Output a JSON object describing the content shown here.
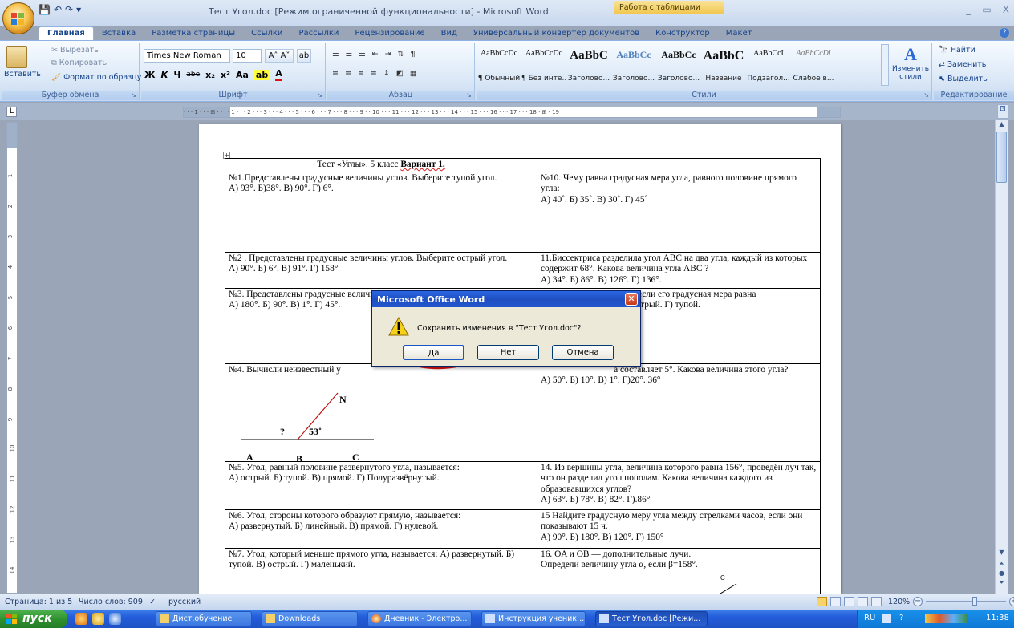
{
  "window": {
    "title": "Тест Угол.doc [Режим ограниченной функциональности] - Microsoft Word",
    "context_group": "Работа с таблицами",
    "controls": [
      "_",
      "▭",
      "X"
    ]
  },
  "qat": [
    "💾",
    "↶",
    "↷",
    "▾"
  ],
  "tabs": [
    "Главная",
    "Вставка",
    "Разметка страницы",
    "Ссылки",
    "Рассылки",
    "Рецензирование",
    "Вид",
    "Универсальный конвертер документов",
    "Конструктор",
    "Макет"
  ],
  "ribbon": {
    "clipboard": {
      "paste": "Вставить",
      "cut": "Вырезать",
      "copy": "Копировать",
      "format": "Формат по образцу",
      "label": "Буфер обмена"
    },
    "font": {
      "name": "Times New Roman",
      "size": "10",
      "label": "Шрифт",
      "row2": [
        "Ж",
        "К",
        "Ч",
        "abe",
        "x₂",
        "x²",
        "Aa"
      ]
    },
    "paragraph": {
      "label": "Абзац"
    },
    "styles": {
      "label": "Стили",
      "items": [
        {
          "sample": "AaBbCcDc",
          "name": "¶ Обычный"
        },
        {
          "sample": "AaBbCcDc",
          "name": "¶ Без инте..."
        },
        {
          "sample": "AaBbC",
          "name": "Заголово..."
        },
        {
          "sample": "AaBbCc",
          "name": "Заголово..."
        },
        {
          "sample": "AaBbCc",
          "name": "Заголово..."
        },
        {
          "sample": "AaBbC",
          "name": "Название"
        },
        {
          "sample": "AaBbCcI",
          "name": "Подзагол..."
        },
        {
          "sample": "AaBbCcDi",
          "name": "Слабое в..."
        }
      ],
      "change": "Изменить стили"
    },
    "editing": {
      "find": "Найти",
      "replace": "Заменить",
      "select": "Выделить",
      "label": "Редактирование"
    }
  },
  "ruler": {
    "h_text": "· · · 1 · · · ⊞ · · · · 1 · · · 2 · · · 3 · · · 4 · · · 5 · · · 6 · · · 7 · · · 8 · · · 9 · · 10 · · · 11 · · · 12 · · · 13 · · · 14 · · · 15 · · · 16 · · · 17 · · · 18 · ⊞ · 19",
    "v_nums": [
      "1",
      "2",
      "3",
      "4",
      "5",
      "6",
      "7",
      "8",
      "9",
      "10",
      "11",
      "12",
      "13",
      "14"
    ]
  },
  "doc": {
    "header_prefix": "Тест «Углы». 5 класс ",
    "header_bold": "Вариант 1.",
    "rows": [
      {
        "left": [
          "№1.Представлены градусные величины углов. Выберите тупой угол.",
          "А) 93°.  Б)38°.  В) 90°. Г) 6°."
        ],
        "right": [
          "№10. Чему равна градусная мера угла, равного половине прямого угла:",
          "А) 40˚. Б) 35˚. В) 30˚. Г) 45˚"
        ]
      },
      {
        "left": [
          "№2 . Представлены градусные величины углов. Выберите острый угол.",
          "А) 90°. Б) 6°. В) 91°. Г) 158°"
        ],
        "right": [
          "11.Биссектриса разделила угол ABC на два угла, каждый из которых содержит 68°. Какова величина угла ABC ?",
          "А) 34°. Б) 86°. В) 126°. Г) 136°."
        ]
      },
      {
        "left": [
          " №3. Представлены градусные величины углов. Выберите прямой угол.",
          "А) 180°. Б) 90°. В) 1°. Г) 45°."
        ],
        "right": [
          "12.Определите вид угла, если его градусная мера равна",
          "                    рнутый. В) острый. Г) тупой."
        ]
      },
      {
        "left": [
          "№4. Вычисли неизвестный у"
        ],
        "right": [
          "                                а составляет 5°. Какова величина этого угла?",
          "А) 50°. Б) 10°. В) 1°. Г)20°. 36°"
        ]
      },
      {
        "left": [
          "№5.  Угол, равный половине развернутого угла, называется:",
          "А) острый.  Б) тупой.  В) прямой. Г) Полуразвёрнутый."
        ],
        "right": [
          "14. Из вершины угла, величина которого равна 156°, проведён луч так, что он разделил угол пополам. Какова величина каждого из образовавшихся углов?",
          "А) 63°. Б) 78°. В) 82°. Г).86°"
        ]
      },
      {
        "left": [
          " №6.  Угол, стороны которого образуют прямую, называется:",
          "А) развернутый. Б) линейный.  В) прямой. Г) нулевой."
        ],
        "right": [
          "15 Найдите градусную меру угла между стрелками часов, если они показывают 15 ч.",
          "А) 90°. Б) 180°. В) 120°. Г) 150°"
        ]
      },
      {
        "left": [
          "№7. Угол, который меньше прямого угла, называется:  А) развернутый. Б) тупой. В) острый. Г) маленький."
        ],
        "right": [
          "16. OA и OB — дополнительные лучи.",
          "Определи величину угла α, если β=158°."
        ]
      }
    ],
    "figure": {
      "n": "N",
      "q": "?",
      "angle": "53˚",
      "a": "A",
      "b": "B",
      "c": "C"
    },
    "figure16": {
      "c": "C"
    }
  },
  "dialog": {
    "title": "Microsoft Office Word",
    "message": "Сохранить изменения в \"Тест Угол.doc\"?",
    "yes": "Да",
    "no": "Нет",
    "cancel": "Отмена"
  },
  "status": {
    "page": "Страница: 1 из 5",
    "words": "Число слов: 909",
    "lang": "русский",
    "zoom": "120%"
  },
  "taskbar": {
    "start": "пуск",
    "items": [
      "Дист.обучение",
      "Downloads",
      "Дневник - Электро...",
      "Инструкция ученик...",
      "Тест Угол.doc [Режи..."
    ],
    "tray_lang": "RU",
    "time": "11:38"
  },
  "colors": {
    "accent": "#15428b",
    "dialog_title": "#2356cd",
    "annotation": "#e01010"
  }
}
